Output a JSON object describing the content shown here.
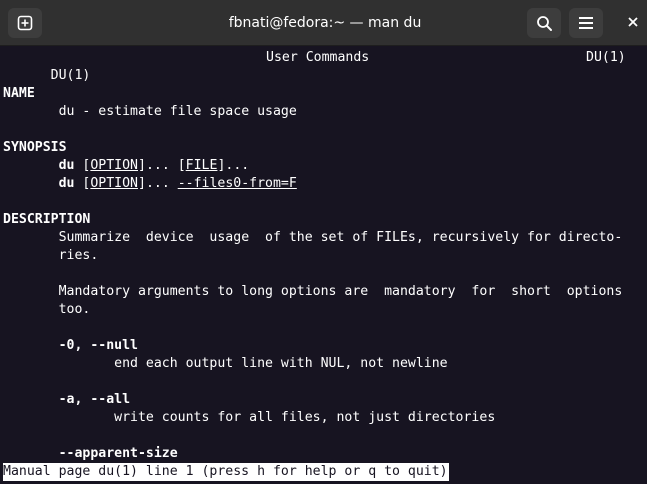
{
  "window": {
    "title": "fbnati@fedora:~ — man du",
    "new_tab_icon": "new-tab-icon",
    "search_icon": "search-icon",
    "menu_icon": "hamburger-menu-icon",
    "close_icon": "close-icon"
  },
  "colors": {
    "terminal_bg": "#171421",
    "headerbar_bg": "#303030",
    "text": "#ffffff"
  },
  "man": {
    "header": {
      "left": "DU(1)",
      "center": "User Commands",
      "right": "DU(1)"
    },
    "name": {
      "heading": "NAME",
      "text": "du - estimate file space usage"
    },
    "synopsis": {
      "heading": "SYNOPSIS",
      "line1": {
        "cmd": "du",
        "opt": "OPTION",
        "sep": "... ",
        "file": "FILE",
        "tail": "..."
      },
      "line2": {
        "cmd": "du",
        "opt": "OPTION",
        "sep": "... ",
        "arg": "--files0-from=F"
      }
    },
    "description": {
      "heading": "DESCRIPTION",
      "para1_line1": "Summarize  device  usage  of the set of FILEs, recursively for directo-",
      "para1_line2": "ries.",
      "para2_line1": "Mandatory arguments to long options are  mandatory  for  short  options",
      "para2_line2": "too.",
      "opt0_flags": "-0, --null",
      "opt0_desc": "end each output line with NUL, not newline",
      "opta_flags": "-a, --all",
      "opta_desc": "write counts for all files, not just directories",
      "apparent_flag": "--apparent-size"
    }
  },
  "status": {
    "text": "Manual page du(1) line 1 (press h for help or q to quit)"
  }
}
